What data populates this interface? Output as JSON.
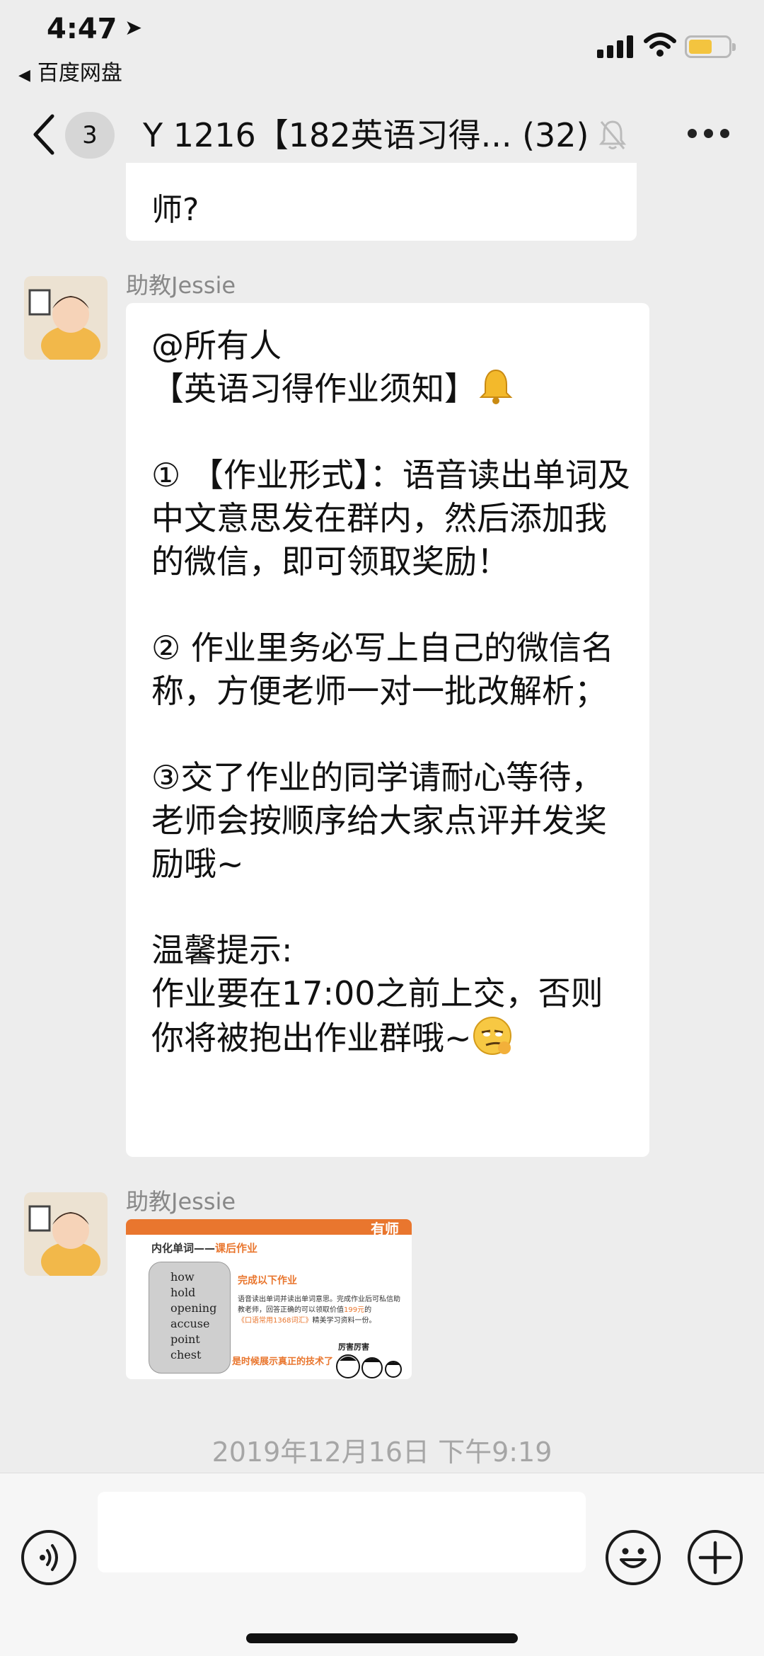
{
  "status_bar": {
    "time": "4:47",
    "location_arrow": "➤",
    "back_to_app": "百度网盘",
    "battery_color": "#f3c43f"
  },
  "nav": {
    "back_icon": "chevron-left-icon",
    "unread_badge": "3",
    "title": "Y 1216【182英语习得... (32)",
    "mute_icon": "bell-muted-icon",
    "more_icon": "more-dots-icon"
  },
  "messages": {
    "previous_tail": "师?",
    "notice": {
      "sender": "助教Jessie",
      "line_at": "@所有人",
      "line_title": "【英语习得作业须知】",
      "item1": "① 【作业形式】：语音读出单词及中文意思发在群内，然后添加我的微信，即可领取奖励！",
      "item2": "② 作业里务必写上自己的微信名称，方便老师一对一批改解析；",
      "item3": "③交了作业的同学请耐心等待，老师会按顺序给大家点评并发奖励哦~",
      "tip_label": "温馨提示:",
      "tip_text": "作业要在17:00之前上交，否则你将被抱出作业群哦~"
    },
    "image": {
      "sender": "助教Jessie",
      "brand": "有师",
      "heading_prefix": "内化单词——",
      "heading_highlight": "课后作业",
      "words": [
        "how",
        "hold",
        "opening",
        "accuse",
        "point",
        "chest"
      ],
      "complete_label": "完成以下作业",
      "instructions_a": "语音读出单词并读出单词意思。完成作业后可私信助教老师，回答正确的可以领取价值",
      "instructions_price": "199元",
      "instructions_b": "的",
      "instructions_book": "《口语常用1368词汇》",
      "instructions_c": "精美学习资料一份。",
      "slogan": "是时候展示真正的技术了",
      "cartoon_caption": "厉害厉害"
    },
    "timestamp": "2019年12月16日 下午9:19"
  },
  "input_bar": {
    "voice_icon": "voice-icon",
    "text_value": "",
    "emoji_icon": "smiley-icon",
    "plus_icon": "plus-icon"
  }
}
